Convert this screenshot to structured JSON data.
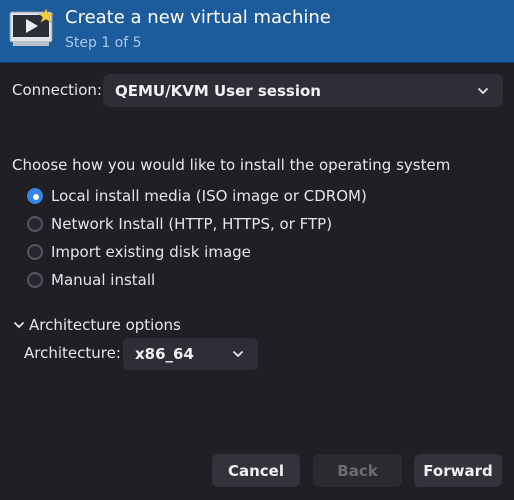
{
  "header": {
    "title": "Create a new virtual machine",
    "subtitle": "Step 1 of 5",
    "icon": "virtual-machine-new-icon"
  },
  "connection": {
    "label": "Connection:",
    "value": "QEMU/KVM User session"
  },
  "install": {
    "prompt": "Choose how you would like to install the operating system",
    "options": [
      {
        "label": "Local install media (ISO image or CDROM)",
        "checked": true
      },
      {
        "label": "Network Install (HTTP, HTTPS, or FTP)",
        "checked": false
      },
      {
        "label": "Import existing disk image",
        "checked": false
      },
      {
        "label": "Manual install",
        "checked": false
      }
    ]
  },
  "architecture": {
    "expander_label": "Architecture options",
    "label": "Architecture:",
    "value": "x86_64"
  },
  "buttons": {
    "cancel": "Cancel",
    "back": "Back",
    "forward": "Forward"
  },
  "colors": {
    "header_bg": "#1c5b9c",
    "window_bg": "#1f1f26",
    "accent": "#3584e4"
  }
}
